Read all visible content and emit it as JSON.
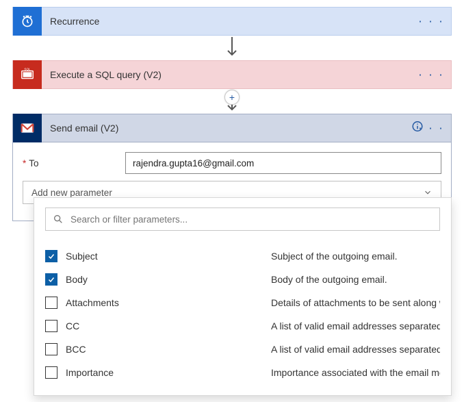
{
  "steps": {
    "recurrence": {
      "title": "Recurrence"
    },
    "sql": {
      "title": "Execute a SQL query (V2)"
    },
    "gmail": {
      "title": "Send email (V2)"
    }
  },
  "gmail_form": {
    "to_label": "To",
    "to_value": "rajendra.gupta16@gmail.com",
    "add_param_label": "Add new parameter",
    "search_placeholder": "Search or filter parameters...",
    "options": [
      {
        "label": "Subject",
        "desc": "Subject of the outgoing email.",
        "checked": true
      },
      {
        "label": "Body",
        "desc": "Body of the outgoing email.",
        "checked": true
      },
      {
        "label": "Attachments",
        "desc": "Details of attachments to be sent along with th...",
        "checked": false
      },
      {
        "label": "CC",
        "desc": "A list of valid email addresses separated by a ...",
        "checked": false
      },
      {
        "label": "BCC",
        "desc": "A list of valid email addresses separated by a ...",
        "checked": false
      },
      {
        "label": "Importance",
        "desc": "Importance associated with the email message.",
        "checked": false
      }
    ]
  }
}
